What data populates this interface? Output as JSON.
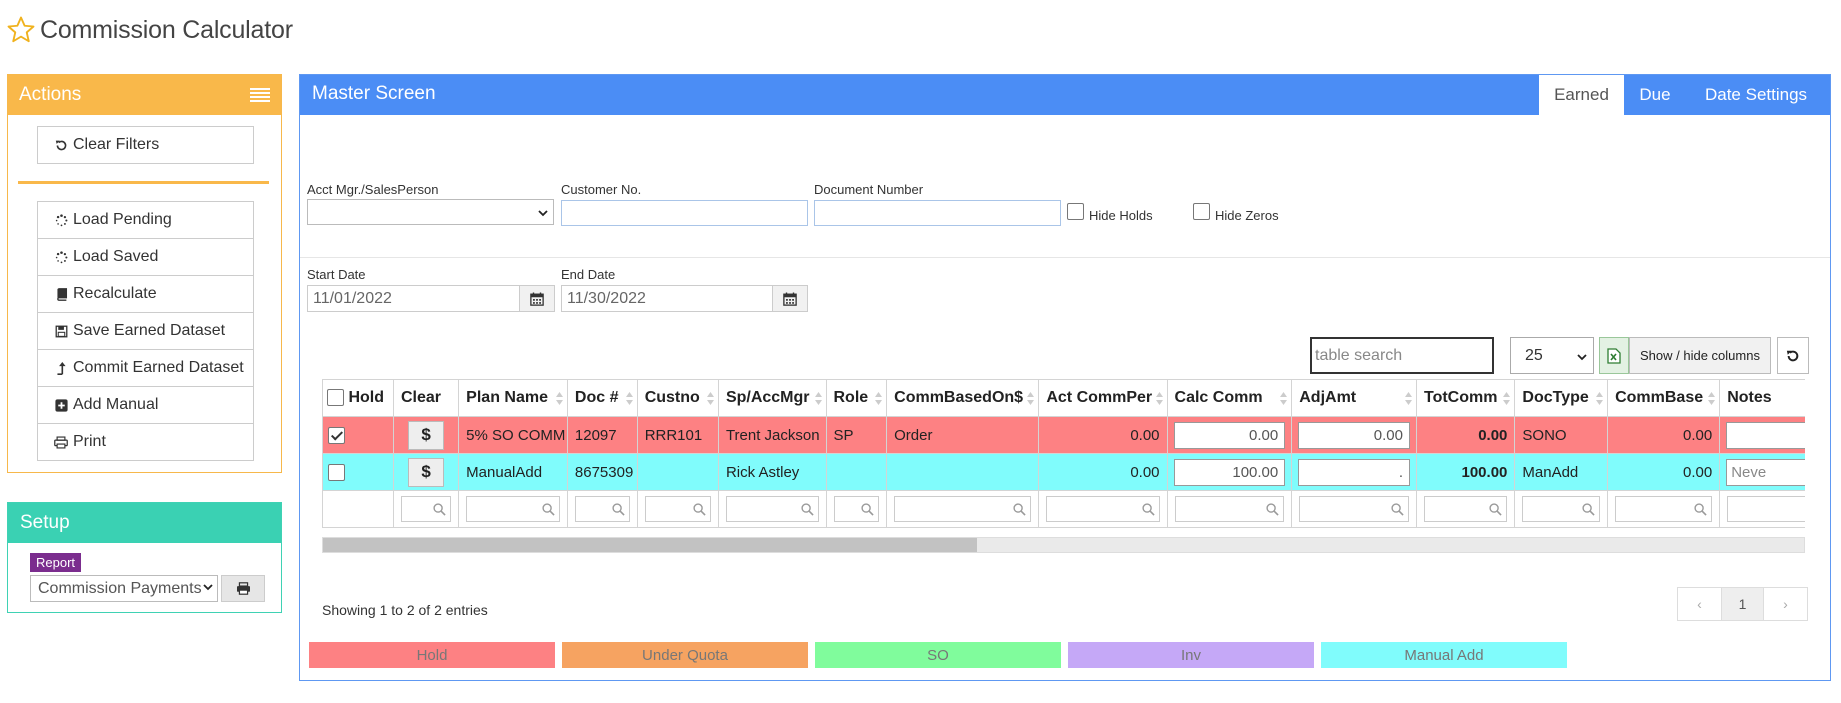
{
  "header": {
    "title": "Commission Calculator",
    "icon": "star-outline-icon"
  },
  "actions": {
    "title": "Actions",
    "clear_filters": "Clear Filters",
    "items": [
      {
        "label": "Load Pending",
        "icon": "spinner-icon"
      },
      {
        "label": "Load Saved",
        "icon": "spinner-icon"
      },
      {
        "label": "Recalculate",
        "icon": "book-icon"
      },
      {
        "label": "Save Earned Dataset",
        "icon": "save-icon"
      },
      {
        "label": "Commit Earned Dataset",
        "icon": "commit-arrow-icon"
      },
      {
        "label": "Add Manual",
        "icon": "plus-square-icon"
      },
      {
        "label": "Print",
        "icon": "printer-icon"
      }
    ]
  },
  "setup": {
    "title": "Setup",
    "report_badge": "Report",
    "report_selected": "Commission Payments"
  },
  "master": {
    "title": "Master Screen",
    "tabs": [
      "Earned",
      "Due",
      "Date Settings"
    ],
    "active_tab": "Earned",
    "filters": {
      "acct_mgr_label": "Acct Mgr./SalesPerson",
      "acct_mgr_value": "",
      "customer_no_label": "Customer No.",
      "customer_no_value": "",
      "document_number_label": "Document Number",
      "document_number_value": "",
      "hide_holds_label": "Hide Holds",
      "hide_zeros_label": "Hide Zeros",
      "start_date_label": "Start Date",
      "start_date_value": "11/01/2022",
      "end_date_label": "End Date",
      "end_date_value": "11/30/2022"
    },
    "toolbar": {
      "search_placeholder": "table search",
      "page_size": "25",
      "show_hide_columns": "Show / hide columns"
    },
    "table": {
      "columns": [
        "Hold",
        "Clear",
        "Plan Name",
        "Doc #",
        "Custno",
        "Sp/AccMgr",
        "Role",
        "CommBasedOn$",
        "Act CommPer",
        "Calc Comm",
        "AdjAmt",
        "TotComm",
        "DocType",
        "CommBase",
        "Notes"
      ],
      "rows": [
        {
          "hold": true,
          "clear": "$",
          "plan_name": "5% SO COMM",
          "doc": "12097",
          "custno": "RRR101",
          "sp": "Trent Jackson",
          "role": "SP",
          "comm_based_on": "Order",
          "act_comm_per": "0.00",
          "calc_comm": "0.00",
          "adj_amt": "0.00",
          "tot_comm": "0.00",
          "doc_type": "SONO",
          "comm_base": "0.00",
          "notes": ""
        },
        {
          "hold": false,
          "clear": "$",
          "plan_name": "ManualAdd",
          "doc": "8675309",
          "custno": "",
          "sp": "Rick Astley",
          "role": "",
          "comm_based_on": "",
          "act_comm_per": "0.00",
          "calc_comm": "100.00",
          "adj_amt": ".",
          "tot_comm": "100.00",
          "doc_type": "ManAdd",
          "comm_base": "0.00",
          "notes": "Neve"
        }
      ]
    },
    "info": "Showing 1 to 2 of 2 entries",
    "pagination": {
      "prev": "‹",
      "current": "1",
      "next": "›"
    },
    "legend": [
      {
        "label": "Hold",
        "color": "#fd8183"
      },
      {
        "label": "Under Quota",
        "color": "#f6a361"
      },
      {
        "label": "SO",
        "color": "#80fc9c"
      },
      {
        "label": "Inv",
        "color": "#c5a8f7"
      },
      {
        "label": "Manual Add",
        "color": "#80fcfc"
      }
    ]
  },
  "colors": {
    "actions_accent": "#f9b84a",
    "setup_accent": "#3ad1b3",
    "master_accent": "#4b8df5",
    "report_badge": "#7b2d8e"
  }
}
